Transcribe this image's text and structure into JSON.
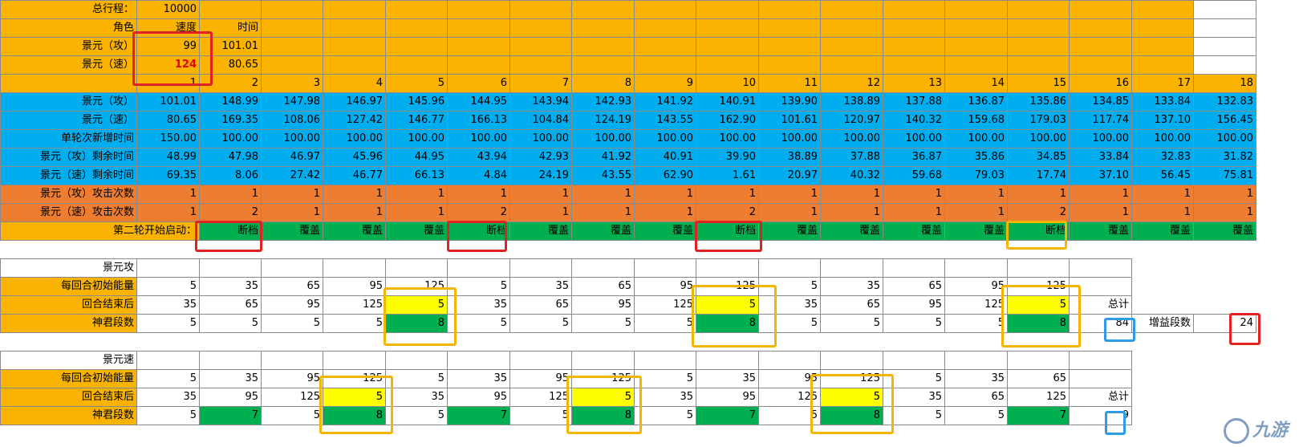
{
  "sheet": {
    "total_distance_label": "总行程：",
    "total_distance_value": "10000",
    "role_label": "角色",
    "speed_header": "速度",
    "time_header": "时间",
    "char_atk": "景元（攻）",
    "char_spd": "景元（速）",
    "atk_speed": "99",
    "atk_time": "101.01",
    "spd_speed": "124",
    "spd_time": "80.65",
    "turns": [
      "1",
      "2",
      "3",
      "4",
      "5",
      "6",
      "7",
      "8",
      "9",
      "10",
      "11",
      "12",
      "13",
      "14",
      "15",
      "16",
      "17",
      "18"
    ],
    "row_labels": {
      "atk_av": "景元（攻）",
      "spd_av": "景元（速）",
      "new_time": "单轮次新增时间",
      "atk_remain": "景元（攻）剩余时间",
      "spd_remain": "景元（速）剩余时间",
      "atk_hits": "景元（攻）攻击次数",
      "spd_hits": "景元（速）攻击次数",
      "round2": "第二轮开始启动："
    },
    "atk_av": [
      "101.01",
      "148.99",
      "147.98",
      "146.97",
      "145.96",
      "144.95",
      "143.94",
      "142.93",
      "141.92",
      "140.91",
      "139.90",
      "138.89",
      "137.88",
      "136.87",
      "135.86",
      "134.85",
      "133.84",
      "132.83"
    ],
    "spd_av": [
      "80.65",
      "169.35",
      "108.06",
      "127.42",
      "146.77",
      "166.13",
      "104.84",
      "124.19",
      "143.55",
      "162.90",
      "101.61",
      "120.97",
      "140.32",
      "159.68",
      "179.03",
      "117.74",
      "137.10",
      "156.45"
    ],
    "new_time": [
      "150.00",
      "100.00",
      "100.00",
      "100.00",
      "100.00",
      "100.00",
      "100.00",
      "100.00",
      "100.00",
      "100.00",
      "100.00",
      "100.00",
      "100.00",
      "100.00",
      "100.00",
      "100.00",
      "100.00",
      "100.00"
    ],
    "atk_remain": [
      "48.99",
      "47.98",
      "46.97",
      "45.96",
      "44.95",
      "43.94",
      "42.93",
      "41.92",
      "40.91",
      "39.90",
      "38.89",
      "37.88",
      "36.87",
      "35.86",
      "34.85",
      "33.84",
      "32.83",
      "31.82"
    ],
    "spd_remain": [
      "69.35",
      "8.06",
      "27.42",
      "46.77",
      "66.13",
      "4.84",
      "24.19",
      "43.55",
      "62.90",
      "1.61",
      "20.97",
      "40.32",
      "59.68",
      "79.03",
      "17.74",
      "37.10",
      "56.45",
      "75.81"
    ],
    "atk_hits": [
      "1",
      "1",
      "1",
      "1",
      "1",
      "1",
      "1",
      "1",
      "1",
      "1",
      "1",
      "1",
      "1",
      "1",
      "1",
      "1",
      "1",
      "1"
    ],
    "spd_hits": [
      "1",
      "2",
      "1",
      "1",
      "1",
      "2",
      "1",
      "1",
      "1",
      "2",
      "1",
      "1",
      "1",
      "1",
      "2",
      "1",
      "1",
      "1"
    ],
    "round2_status": [
      "断档",
      "覆盖",
      "覆盖",
      "覆盖",
      "断档",
      "覆盖",
      "覆盖",
      "覆盖",
      "断档",
      "覆盖",
      "覆盖",
      "覆盖",
      "覆盖",
      "断档",
      "覆盖",
      "覆盖",
      "覆盖"
    ]
  },
  "atk_block": {
    "title": "景元攻",
    "start_energy_label": "每回合初始能量",
    "end_energy_label": "回合结束后",
    "stacks_label": "神君段数",
    "start_energy": [
      "5",
      "35",
      "65",
      "95",
      "125",
      "5",
      "35",
      "65",
      "95",
      "125",
      "5",
      "35",
      "65",
      "95",
      "125"
    ],
    "end_energy": [
      "35",
      "65",
      "95",
      "125",
      "5",
      "35",
      "65",
      "95",
      "125",
      "5",
      "35",
      "65",
      "95",
      "125",
      "5"
    ],
    "stacks": [
      "5",
      "5",
      "5",
      "5",
      "8",
      "5",
      "5",
      "5",
      "5",
      "8",
      "5",
      "5",
      "5",
      "5",
      "8"
    ],
    "total_label": "总计",
    "total_value": "84",
    "gain_label": "增益段数",
    "gain_value": "24"
  },
  "spd_block": {
    "title": "景元速",
    "start_energy_label": "每回合初始能量",
    "end_energy_label": "回合结束后",
    "stacks_label": "神君段数",
    "start_energy": [
      "5",
      "35",
      "95",
      "125",
      "5",
      "35",
      "95",
      "125",
      "5",
      "35",
      "95",
      "125",
      "5",
      "35",
      "65"
    ],
    "end_energy": [
      "35",
      "95",
      "125",
      "5",
      "35",
      "95",
      "125",
      "5",
      "35",
      "95",
      "125",
      "5",
      "35",
      "65",
      "125"
    ],
    "stacks": [
      "5",
      "7",
      "5",
      "8",
      "5",
      "7",
      "5",
      "8",
      "5",
      "7",
      "5",
      "8",
      "5",
      "5",
      "7"
    ],
    "total_label": "总计",
    "total_value_partial": "9"
  },
  "watermark": {
    "text": "九游",
    "icon": "jiuyou-logo-icon"
  },
  "colors": {
    "orange": "#f9b300",
    "blue": "#00aeef",
    "salmon": "#ed7d31",
    "green": "#00b050",
    "yellow": "#ffff00",
    "red_box": "#e22222",
    "gold_box": "#f5b400",
    "blue_box": "#2e9be6"
  }
}
